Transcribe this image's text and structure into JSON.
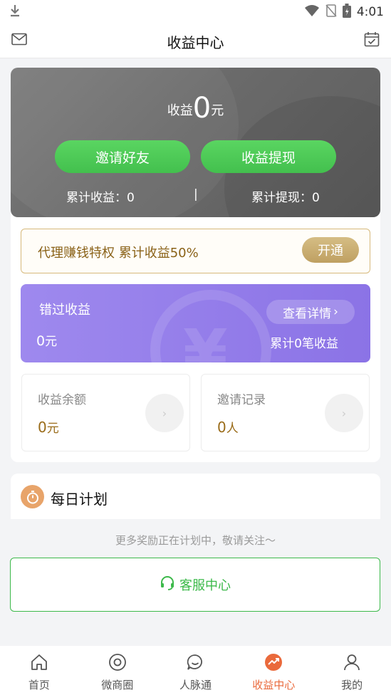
{
  "status_bar": {
    "time": "4:01"
  },
  "header": {
    "title": "收益中心",
    "left_icon": "mail-icon",
    "right_icon": "calendar-check-icon"
  },
  "hero": {
    "earn_label": "收益",
    "earn_value": "0",
    "earn_unit": "元",
    "invite_button": "邀请好友",
    "withdraw_button": "收益提现",
    "total_earn": "累计收益：0",
    "separator": "|",
    "total_withdraw": "累计提现：0"
  },
  "vip": {
    "text": "代理赚钱特权 累计收益50%",
    "button": "开通"
  },
  "missed": {
    "title": "错过收益",
    "amount": "0",
    "amount_unit": "元",
    "detail_button": "查看详情",
    "detail_chevron": "›",
    "count_text": "累计0笔收益"
  },
  "boxes": [
    {
      "label": "收益余额",
      "value": "0",
      "unit": "元",
      "chevron": "›"
    },
    {
      "label": "邀请记录",
      "value": "0",
      "unit": "人",
      "chevron": "›"
    }
  ],
  "daily_plan": {
    "title": "每日计划"
  },
  "more_text": "更多奖励正在计划中，敬请关注～",
  "service": {
    "label": "客服中心"
  },
  "tabs": [
    {
      "label": "首页",
      "icon": "home-icon",
      "active": false
    },
    {
      "label": "微商圈",
      "icon": "circle-icon",
      "active": false
    },
    {
      "label": "人脉通",
      "icon": "chat-icon",
      "active": false
    },
    {
      "label": "收益中心",
      "icon": "trend-icon",
      "active": true
    },
    {
      "label": "我的",
      "icon": "user-icon",
      "active": false
    }
  ],
  "colors": {
    "accent_green": "#43c04e",
    "accent_orange": "#ea6a3c",
    "purple": "#8b73e6",
    "gold": "#bfa062"
  }
}
